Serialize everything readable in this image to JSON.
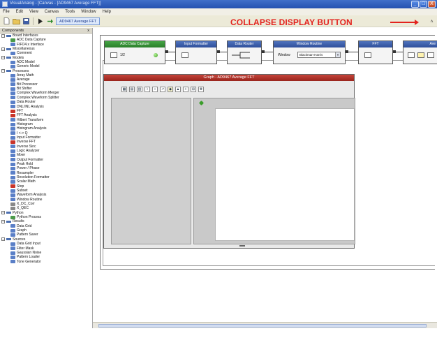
{
  "window": {
    "title": "VisualAnalog - [Canvas - [AD9467 Average FFT]]",
    "controls": [
      "_",
      "□",
      "X"
    ]
  },
  "menu": [
    "File",
    "Edit",
    "View",
    "Canvas",
    "Tools",
    "Window",
    "Help"
  ],
  "toolbar": {
    "icons": [
      "new-file-icon",
      "open-folder-icon",
      "save-icon",
      "run-icon",
      "continuous-run-icon"
    ],
    "canvas_tab": "AD9467 Average FFT"
  },
  "annotation": {
    "label": "COLLAPSE DISPLAY BUTTON",
    "color": "#e3231e"
  },
  "collapse_button_glyph": "˄",
  "components": {
    "header": "Components",
    "close_glyph": "x",
    "tree": [
      {
        "type": "cat",
        "label": "Board Interfaces"
      },
      {
        "type": "item",
        "label": "ADC Data Capture",
        "icon": "green"
      },
      {
        "type": "item",
        "label": "FIFO4.x Interface",
        "icon": "blue"
      },
      {
        "type": "cat",
        "label": "Miscellaneous"
      },
      {
        "type": "item",
        "label": "Comment",
        "icon": "blue"
      },
      {
        "type": "cat",
        "label": "Models"
      },
      {
        "type": "item",
        "label": "ADC Model",
        "icon": "blue"
      },
      {
        "type": "item",
        "label": "Generic Model",
        "icon": "blue"
      },
      {
        "type": "cat",
        "label": "Processes"
      },
      {
        "type": "item",
        "label": "Array Math",
        "icon": "blue"
      },
      {
        "type": "item",
        "label": "Average",
        "icon": "blue"
      },
      {
        "type": "item",
        "label": "Bit Processor",
        "icon": "blue"
      },
      {
        "type": "item",
        "label": "Bit Shifter",
        "icon": "blue"
      },
      {
        "type": "item",
        "label": "Complex Waveform Merger",
        "icon": "blue"
      },
      {
        "type": "item",
        "label": "Complex Waveform Splitter",
        "icon": "blue"
      },
      {
        "type": "item",
        "label": "Data Router",
        "icon": "blue"
      },
      {
        "type": "item",
        "label": "DNL/INL Analysis",
        "icon": "blue"
      },
      {
        "type": "item",
        "label": "FFT",
        "icon": "red"
      },
      {
        "type": "item",
        "label": "FFT Analysis",
        "icon": "red"
      },
      {
        "type": "item",
        "label": "Hilbert Transform",
        "icon": "blue"
      },
      {
        "type": "item",
        "label": "Histogram",
        "icon": "blue"
      },
      {
        "type": "item",
        "label": "Histogram Analysis",
        "icon": "blue"
      },
      {
        "type": "item",
        "label": "I <-> Q",
        "icon": "blue"
      },
      {
        "type": "item",
        "label": "Input Formatter",
        "icon": "blue"
      },
      {
        "type": "item",
        "label": "Inverse FFT",
        "icon": "red"
      },
      {
        "type": "item",
        "label": "Inverse Sinc",
        "icon": "blue"
      },
      {
        "type": "item",
        "label": "Logic Analyzer",
        "icon": "blue"
      },
      {
        "type": "item",
        "label": "Mixer",
        "icon": "blue"
      },
      {
        "type": "item",
        "label": "Output Formatter",
        "icon": "blue"
      },
      {
        "type": "item",
        "label": "Peak Hold",
        "icon": "blue"
      },
      {
        "type": "item",
        "label": "Power / Phase",
        "icon": "blue"
      },
      {
        "type": "item",
        "label": "Resampler",
        "icon": "blue"
      },
      {
        "type": "item",
        "label": "Resolution Formatter",
        "icon": "blue"
      },
      {
        "type": "item",
        "label": "Scalar Math",
        "icon": "blue"
      },
      {
        "type": "item",
        "label": "Stop",
        "icon": "red"
      },
      {
        "type": "item",
        "label": "Subset",
        "icon": "blue"
      },
      {
        "type": "item",
        "label": "Waveform Analysis",
        "icon": "blue"
      },
      {
        "type": "item",
        "label": "Window Routine",
        "icon": "blue"
      },
      {
        "type": "item",
        "label": "X_DC_Corr",
        "icon": "gray"
      },
      {
        "type": "item",
        "label": "X_QEC",
        "icon": "gray"
      },
      {
        "type": "cat",
        "label": "Python"
      },
      {
        "type": "item",
        "label": "Python Process",
        "icon": "green"
      },
      {
        "type": "cat",
        "label": "Results"
      },
      {
        "type": "item",
        "label": "Data Grid",
        "icon": "blue"
      },
      {
        "type": "item",
        "label": "Graph",
        "icon": "blue"
      },
      {
        "type": "item",
        "label": "Pattern Saver",
        "icon": "blue"
      },
      {
        "type": "cat",
        "label": "Sources"
      },
      {
        "type": "item",
        "label": "Data Grid Input",
        "icon": "blue"
      },
      {
        "type": "item",
        "label": "Filter Mask",
        "icon": "blue"
      },
      {
        "type": "item",
        "label": "Gaussian Noise",
        "icon": "blue"
      },
      {
        "type": "item",
        "label": "Pattern Loader",
        "icon": "blue"
      },
      {
        "type": "item",
        "label": "Tone Generator",
        "icon": "blue"
      }
    ]
  },
  "blocks": {
    "adc_capture": {
      "title": "ADC Data Capture",
      "value": "1/2"
    },
    "input_formatter": {
      "title": "Input Formatter"
    },
    "data_router": {
      "title": "Data Router"
    },
    "window_routine": {
      "title": "Window Routine",
      "field_label": "Window",
      "selected": "Blackman-Harris"
    },
    "fft": {
      "title": "FFT"
    },
    "average": {
      "title": "Ave"
    }
  },
  "graph": {
    "title": "Graph - AD9467 Average FFT"
  }
}
